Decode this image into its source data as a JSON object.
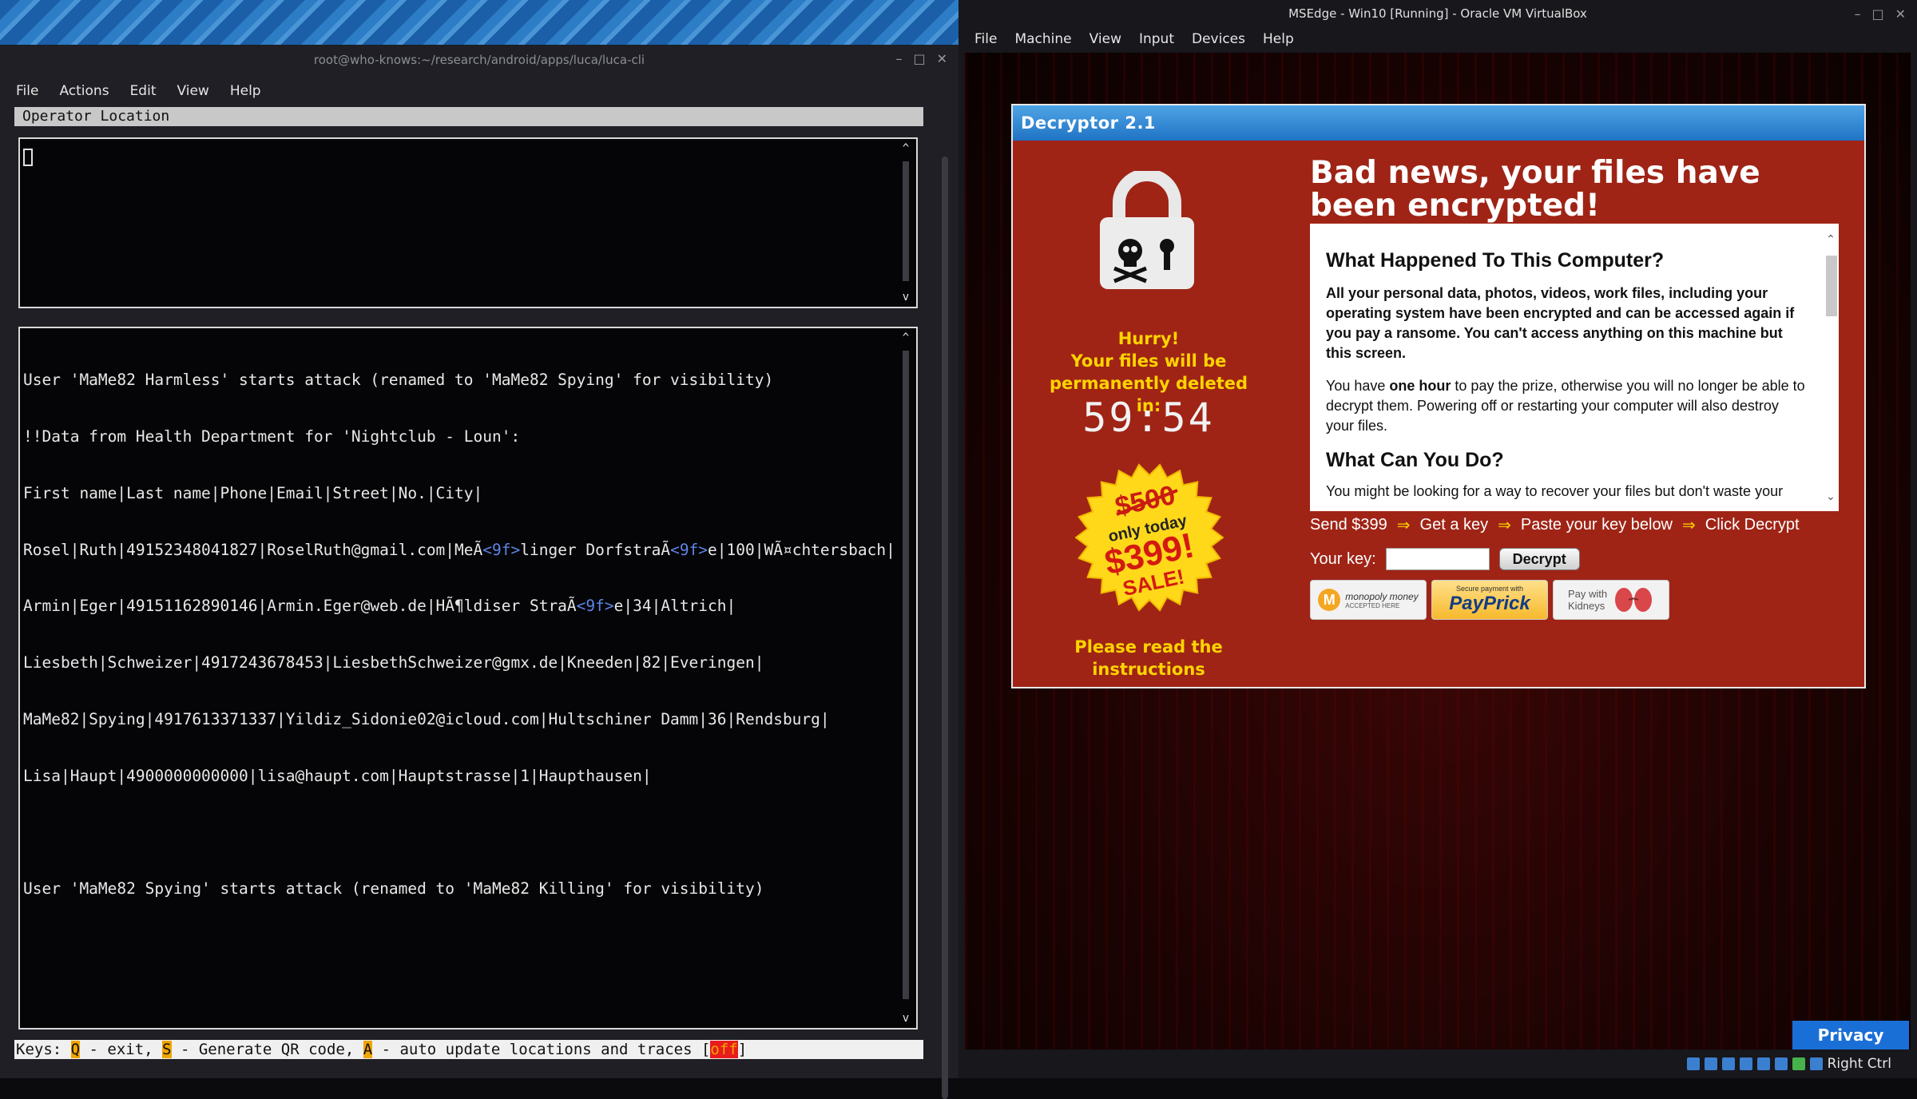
{
  "terminal": {
    "title": "root@who-knows:~/research/android/apps/luca/luca-cli",
    "menu": [
      "File",
      "Actions",
      "Edit",
      "View",
      "Help"
    ],
    "section_header": "Operator Location",
    "log_lines": [
      "User 'MaMe82 Harmless' starts attack (renamed to 'MaMe82 Spying' for visibility)",
      "!!Data from Health Department for 'Nightclub - Loun':",
      "First name|Last name|Phone|Email|Street|No.|City|",
      "Rosel|Ruth|49152348041827|RoselRuth@gmail.com|MeÃ<9f>linger DorfstraÃ<9f>e|100|WÃ¤chtersbach|",
      "Armin|Eger|49151162890146|Armin.Eger@web.de|HÃ¶ldiser StraÃ<9f>e|34|Altrich|",
      "Liesbeth|Schweizer|4917243678453|LiesbethSchweizer@gmx.de|Kneeden|82|Everingen|",
      "MaMe82|Spying|4917613371337|Yildiz_Sidonie02@icloud.com|Hultschiner Damm|36|Rendsburg|",
      "Lisa|Haupt|4900000000000|lisa@haupt.com|Hauptstrasse|1|Haupthausen|",
      "",
      "User 'MaMe82 Spying' starts attack (renamed to 'MaMe82 Killing' for visibility)"
    ],
    "keys_bar": {
      "prefix": "Keys: ",
      "q_key": "Q",
      "q_text": " - exit, ",
      "s_key": "S",
      "s_text": " - Generate QR code, ",
      "a_key": "A",
      "a_text": " - auto update locations and traces [",
      "state": "off",
      "suffix": "]"
    }
  },
  "vbox": {
    "title": "MSEdge - Win10 [Running] - Oracle VM VirtualBox",
    "menu": [
      "File",
      "Machine",
      "View",
      "Input",
      "Devices",
      "Help"
    ],
    "privacy_label": "Privacy",
    "host_key": "Right Ctrl"
  },
  "decryptor": {
    "title": "Decryptor 2.1",
    "hurry": "Hurry!",
    "deleted_msg": "Your files will be permanently deleted in:",
    "countdown": "59:54",
    "badge": {
      "old_price": "$500",
      "only_today": "only today",
      "new_price": "$399!",
      "sale": "SALE!"
    },
    "read_instructions": "Please read the instructions",
    "headline": "Bad news, your files have been encrypted!",
    "info": {
      "heading1": "What Happened To This Computer?",
      "para1": "All your personal data, photos, videos, work files, including your operating system have been encrypted and can be accessed again if you pay a ransome. You can't access anything on this machine but this screen.",
      "para2_pre": "You have ",
      "para2_bold": "one hour",
      "para2_post": " to pay the prize, otherwise you will no longer be able to decrypt them. Powering off or restarting your computer will also destroy your files.",
      "heading2": "What Can You Do?",
      "para3": "You might be looking for a way to recover your files but don't waste your"
    },
    "steps": [
      "Send $399",
      "Get a key",
      "Paste your key below",
      "Click Decrypt"
    ],
    "step_arrow": "⇒",
    "key_label": "Your key:",
    "key_value": "",
    "decrypt_label": "Decrypt",
    "payments": {
      "monopoly_top": "monopoly money",
      "monopoly_sub": "ACCEPTED HERE",
      "payprick_top": "Secure payment with",
      "payprick": "PayPrick",
      "kidneys": "Pay with Kidneys"
    }
  }
}
